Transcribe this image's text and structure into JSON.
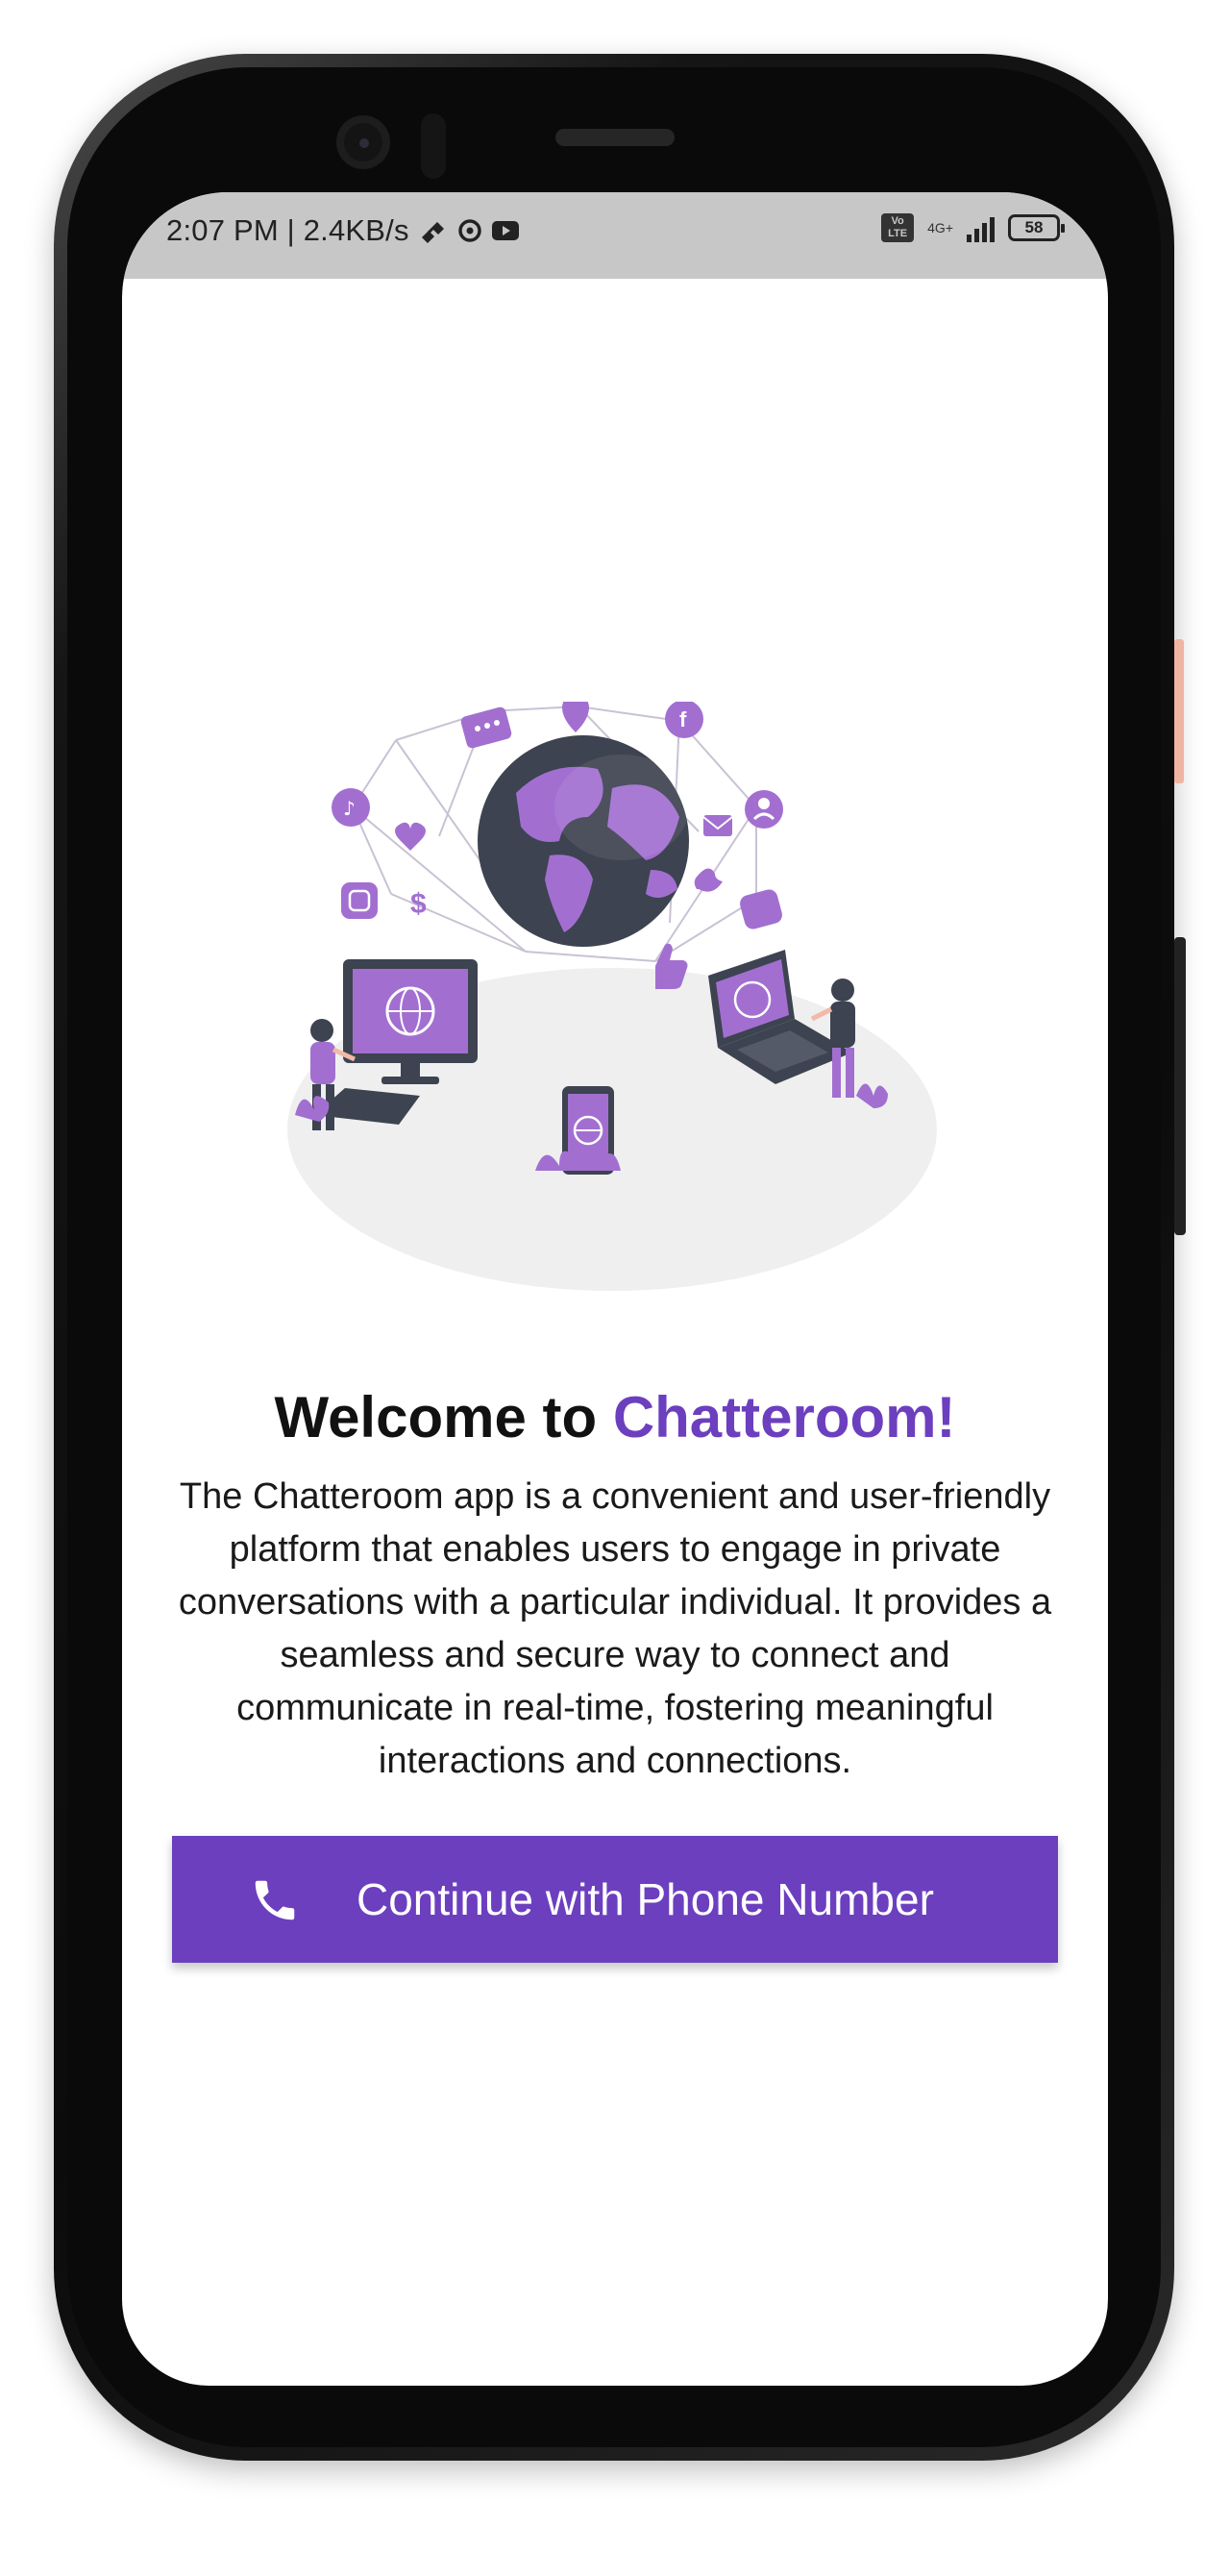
{
  "statusbar": {
    "time_and_speed": "2:07 PM | 2.4KB/s",
    "network_type": "4G+",
    "volte_top": "Vo",
    "volte_bottom": "LTE",
    "battery": "58"
  },
  "welcome": {
    "prefix": "Welcome to ",
    "brand": "Chatteroom!"
  },
  "description": "The Chatteroom app is a convenient and user-friendly platform that enables users to engage in private conversations with a particular individual. It provides a seamless and secure way to connect and communicate in real-time, fostering meaningful interactions and connections.",
  "cta": {
    "label": "Continue with Phone Number",
    "icon": "phone-icon"
  },
  "colors": {
    "brand": "#6c3fbf",
    "status_bar": "#c7c7c7",
    "illustration_purple": "#a26fd1",
    "illustration_dark": "#3d4350"
  }
}
